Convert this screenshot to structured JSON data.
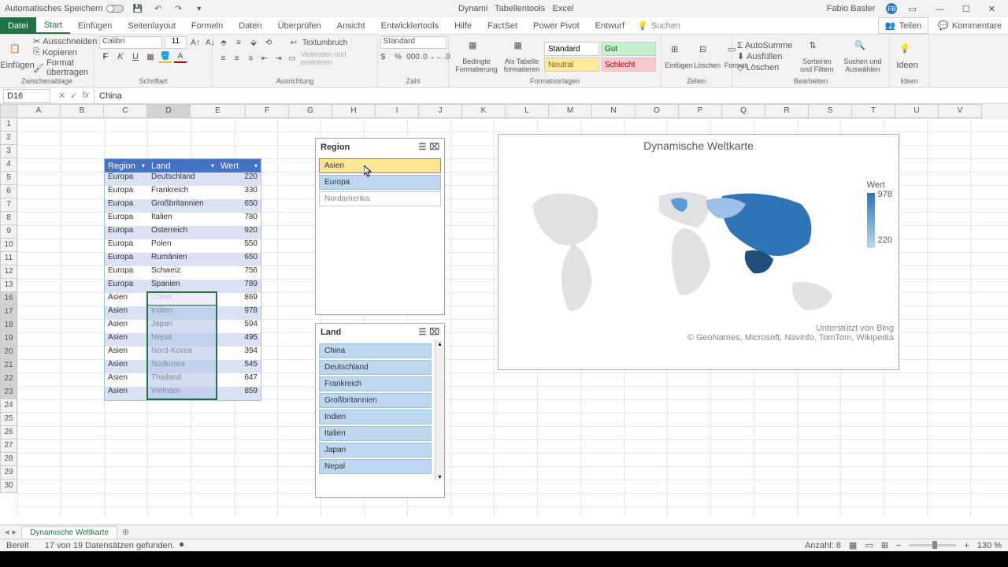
{
  "titlebar": {
    "autosave": "Automatisches Speichern",
    "doc_title": "Dynamische Weltkarte - Excel",
    "context_tab": "Tabellentools",
    "user": "Fabio Basler",
    "user_initials": "FB"
  },
  "tabs": {
    "file": "Datei",
    "home": "Start",
    "insert": "Einfügen",
    "pagelayout": "Seitenlayout",
    "formulas": "Formeln",
    "data": "Daten",
    "review": "Überprüfen",
    "view": "Ansicht",
    "developer": "Entwicklertools",
    "help": "Hilfe",
    "factset": "FactSet",
    "powerpivot": "Power Pivot",
    "design": "Entwurf",
    "search": "Suchen",
    "share": "Teilen",
    "comments": "Kommentare"
  },
  "ribbon": {
    "clipboard": {
      "paste": "Einfügen",
      "cut": "Ausschneiden",
      "copy": "Kopieren",
      "format_painter": "Format übertragen",
      "label": "Zwischenablage"
    },
    "font": {
      "name": "Calibri",
      "size": "11",
      "label": "Schriftart"
    },
    "alignment": {
      "wrap": "Textumbruch",
      "merge": "Verbinden und zentrieren",
      "label": "Ausrichtung"
    },
    "number": {
      "format": "Standard",
      "label": "Zahl"
    },
    "styles": {
      "cond": "Bedingte Formatierung",
      "table": "Als Tabelle formatieren",
      "standard": "Standard",
      "gut": "Gut",
      "neutral": "Neutral",
      "schlecht": "Schlecht",
      "label": "Formatvorlagen"
    },
    "cells": {
      "insert": "Einfügen",
      "delete": "Löschen",
      "format": "Format",
      "label": "Zellen"
    },
    "editing": {
      "sum": "AutoSumme",
      "fill": "Ausfüllen",
      "clear": "Löschen",
      "sort": "Sortieren und Filtern",
      "find": "Suchen und Auswählen",
      "label": "Bearbeiten"
    },
    "ideas": {
      "btn": "Ideen",
      "label": "Ideen"
    }
  },
  "namebox": {
    "ref": "D16",
    "formula": "China"
  },
  "columns": [
    "A",
    "B",
    "C",
    "D",
    "E",
    "F",
    "G",
    "H",
    "I",
    "J",
    "K",
    "L",
    "M",
    "N",
    "O",
    "P",
    "Q",
    "R",
    "S",
    "T",
    "U",
    "V"
  ],
  "visible_rows": [
    1,
    2,
    3,
    4,
    5,
    6,
    7,
    8,
    9,
    10,
    11,
    12,
    13,
    16,
    17,
    18,
    19,
    20,
    21,
    22,
    23,
    24,
    25,
    26,
    27,
    28,
    29,
    30
  ],
  "table": {
    "headers": {
      "region": "Region",
      "land": "Land",
      "wert": "Wert"
    },
    "rows": [
      {
        "region": "Europa",
        "land": "Deutschland",
        "wert": "220"
      },
      {
        "region": "Europa",
        "land": "Frankreich",
        "wert": "330"
      },
      {
        "region": "Europa",
        "land": "Großbritannien",
        "wert": "650"
      },
      {
        "region": "Europa",
        "land": "Italien",
        "wert": "780"
      },
      {
        "region": "Europa",
        "land": "Österreich",
        "wert": "920"
      },
      {
        "region": "Europa",
        "land": "Polen",
        "wert": "550"
      },
      {
        "region": "Europa",
        "land": "Rumänien",
        "wert": "650"
      },
      {
        "region": "Europa",
        "land": "Schweiz",
        "wert": "756"
      },
      {
        "region": "Europa",
        "land": "Spanien",
        "wert": "789"
      },
      {
        "region": "Asien",
        "land": "China",
        "wert": "869"
      },
      {
        "region": "Asien",
        "land": "Indien",
        "wert": "978"
      },
      {
        "region": "Asien",
        "land": "Japan",
        "wert": "594"
      },
      {
        "region": "Asien",
        "land": "Nepal",
        "wert": "495"
      },
      {
        "region": "Asien",
        "land": "Nord-Korea",
        "wert": "394"
      },
      {
        "region": "Asien",
        "land": "Südkorea",
        "wert": "545"
      },
      {
        "region": "Asien",
        "land": "Thailand",
        "wert": "647"
      },
      {
        "region": "Asien",
        "land": "Vietnam",
        "wert": "859"
      }
    ]
  },
  "slicer_region": {
    "title": "Region",
    "items": [
      "Asien",
      "Europa",
      "Nordamerika"
    ]
  },
  "slicer_land": {
    "title": "Land",
    "items": [
      "China",
      "Deutschland",
      "Frankreich",
      "Großbritannien",
      "Indien",
      "Italien",
      "Japan",
      "Nepal"
    ]
  },
  "chart": {
    "title": "Dynamische Weltkarte",
    "legend_label": "Wert",
    "max": "978",
    "min": "220",
    "attr1": "Unterstützt von Bing",
    "attr2": "© GeoNames, Microsoft, Navinfo, TomTom, Wikipedia"
  },
  "chart_data": {
    "type": "map",
    "title": "Dynamische Weltkarte",
    "value_field": "Wert",
    "color_scale": {
      "min": 220,
      "max": 978,
      "low_color": "#bdd7ee",
      "high_color": "#2e75b6"
    },
    "series": [
      {
        "country": "Deutschland",
        "value": 220
      },
      {
        "country": "Frankreich",
        "value": 330
      },
      {
        "country": "Großbritannien",
        "value": 650
      },
      {
        "country": "Italien",
        "value": 780
      },
      {
        "country": "Österreich",
        "value": 920
      },
      {
        "country": "Polen",
        "value": 550
      },
      {
        "country": "Rumänien",
        "value": 650
      },
      {
        "country": "Schweiz",
        "value": 756
      },
      {
        "country": "Spanien",
        "value": 789
      },
      {
        "country": "China",
        "value": 869
      },
      {
        "country": "Indien",
        "value": 978
      },
      {
        "country": "Japan",
        "value": 594
      },
      {
        "country": "Nepal",
        "value": 495
      },
      {
        "country": "Nord-Korea",
        "value": 394
      },
      {
        "country": "Südkorea",
        "value": 545
      },
      {
        "country": "Thailand",
        "value": 647
      },
      {
        "country": "Vietnam",
        "value": 859
      }
    ]
  },
  "sheet": {
    "name": "Dynamische Weltkarte"
  },
  "status": {
    "ready": "Bereit",
    "found": "17 von 19 Datensätzen gefunden.",
    "count": "Anzahl: 8",
    "zoom": "130 %"
  }
}
